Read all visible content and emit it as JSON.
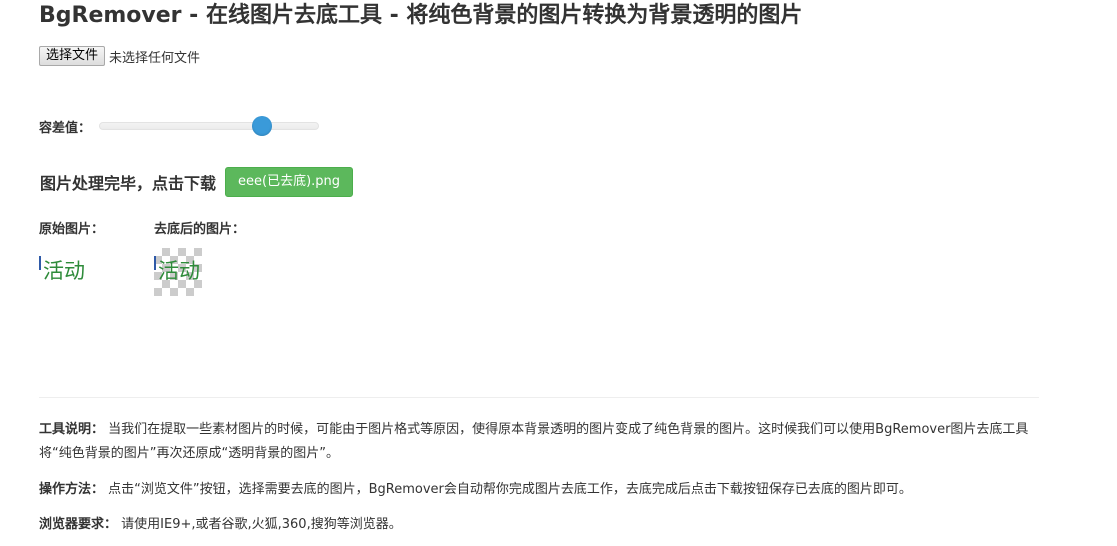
{
  "header": {
    "title": "BgRemover - 在线图片去底工具 - 将纯色背景的图片转换为背景透明的图片"
  },
  "file_input": {
    "button_label": "选择文件",
    "status": "未选择任何文件"
  },
  "tolerance": {
    "label": "容差值：",
    "value_fraction": 0.74
  },
  "result": {
    "done_text": "图片处理完毕，点击下载",
    "download_label": "eee(已去底).png",
    "download_color": "#5cb85c"
  },
  "images": {
    "original_label": "原始图片：",
    "processed_label": "去底后的图片：",
    "image_text": "活动",
    "text_color": "#2e8b3a"
  },
  "info": {
    "description_label": "工具说明：",
    "description_text": "当我们在提取一些素材图片的时候，可能由于图片格式等原因，使得原本背景透明的图片变成了纯色背景的图片。这时候我们可以使用BgRemover图片去底工具将“纯色背景的图片”再次还原成“透明背景的图片”。",
    "method_label": "操作方法：",
    "method_text": "点击“浏览文件”按钮，选择需要去底的图片，BgRemover会自动帮你完成图片去底工作，去底完成后点击下载按钮保存已去底的图片即可。",
    "browser_label": "浏览器要求：",
    "browser_text": "请使用IE9+,或者谷歌,火狐,360,搜狗等浏览器。"
  }
}
